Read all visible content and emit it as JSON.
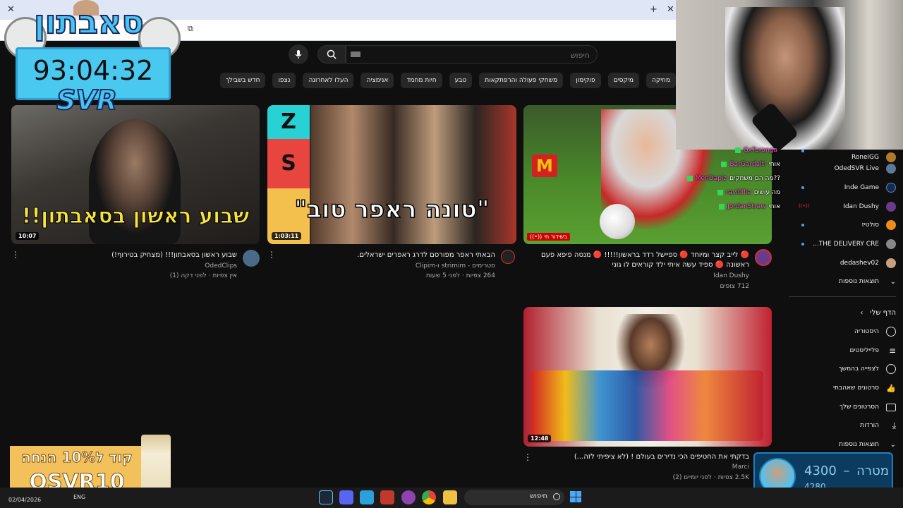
{
  "search": {
    "placeholder": "חיפוש"
  },
  "chips": [
    "מוזיקה",
    "מיקסים",
    "פוקימון",
    "משחקי פעולה והרפתקאות",
    "טבע",
    "חיות מחמד",
    "אנימציה",
    "העלו לאחרונה",
    "נצפו",
    "חדש בשבילך"
  ],
  "videos": [
    {
      "title": "שבוע ראשון בסאבתון!!! (מצחיק בטירוף!)",
      "channel": "OdedClips",
      "meta": "אין צפיות · לפני דקה (1)",
      "duration": "10:07",
      "thumb_text": "שבוע ראשון בסאבתון!!"
    },
    {
      "title": "הבאתי ראפר מפורסם לדרג ראפרים ישראלים.",
      "channel": "סטרימים - strimim ו-Clipim",
      "meta": "264 צפיות · לפני 5 שעות",
      "duration": "1:03:11",
      "thumb_text": "\"טונה ראפר טוב\""
    },
    {
      "title_line1": "🔴 לייב קצר ומיוחד 🔴 ספיישל רדד בראשון!!!!! 🔴 מנסה פיפא פעם",
      "title_line2": "ראשונה 🔴 ספיד עשה איתי ילד קוראים לו גוני",
      "channel": "Idan Dushy",
      "meta": "712 צופים",
      "live_badge": "בשידור חי"
    },
    {
      "title": "בדקתי את החטיפים הכי נדירים בעולם ! (לא ציפיתי לזה...)",
      "channel": "Marci",
      "meta": "2.5K צפיות · לפני יומיים (2)",
      "duration": "12:48"
    }
  ],
  "sidebar": {
    "subs": [
      "RoneiGG",
      "OdedSVR Live",
      "Inde Game",
      "Idan Dushy",
      "סולטיז",
      "THE DELIVERY CRE...",
      "dedashev02"
    ],
    "more_subs": "תוצאות נוספות",
    "you_header": "הדף שלי",
    "you_items": [
      "היסטוריה",
      "פלייליסטים",
      "לצפייה בהמשך",
      "סרטונים שאהבתי",
      "הסרטונים שלך",
      "הורדות",
      "תוצאות נוספות"
    ]
  },
  "chat": [
    {
      "name": "GxTuranga",
      "text": ""
    },
    {
      "name": "BarGardalti",
      "text": "אוחי"
    },
    {
      "name": "MenDapiz",
      "text": "??מה הם משחקים"
    },
    {
      "name": "ravi0llie",
      "text": "מה עושים"
    },
    {
      "name": "JordanStraw",
      "text": "אוחי"
    }
  ],
  "overlay": {
    "logo": "סאבתון",
    "timer": "93:04:32",
    "svr": "SVR",
    "promo_line1": "קוד ל10% הנחה",
    "promo_line2": "OSVR10",
    "goal_label": "מטרה",
    "goal_target": "4300",
    "goal_current": "4280"
  },
  "taskbar": {
    "date": "02/04/2026",
    "lang": "ENG",
    "search": "חיפוש"
  }
}
